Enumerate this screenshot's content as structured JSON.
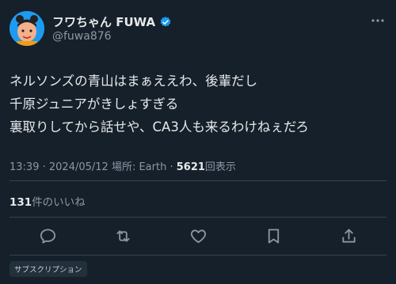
{
  "author": {
    "display_name": "フワちゃん FUWA",
    "handle": "@fuwa876",
    "avatar_icon": "avatar-photo",
    "verified_icon": "verified-badge-icon"
  },
  "tweet": {
    "lines": [
      "ネルソンズの青山はまぁええわ、後輩だし",
      "千原ジュニアがきしょすぎる",
      "裏取りしてから話せや、CA3人も来るわけねぇだろ"
    ]
  },
  "meta": {
    "time": "13:39",
    "separator1": " · ",
    "date": "2024/05/12",
    "separator2": " ",
    "location": "場所: Earth",
    "separator3": " · ",
    "views_count": "5621",
    "views_label": "回表示"
  },
  "likes": {
    "count": "131",
    "label": "件のいいね"
  },
  "actions": {
    "reply_icon": "reply-icon",
    "retweet_icon": "retweet-icon",
    "like_icon": "heart-icon",
    "bookmark_icon": "bookmark-icon",
    "share_icon": "share-icon"
  },
  "badge": {
    "label": "サブスクリプション"
  },
  "colors": {
    "background": "#15202b",
    "text": "#e7e9ea",
    "secondary": "#8b98a5",
    "accent": "#1d9bf0",
    "divider": "#38444d"
  }
}
